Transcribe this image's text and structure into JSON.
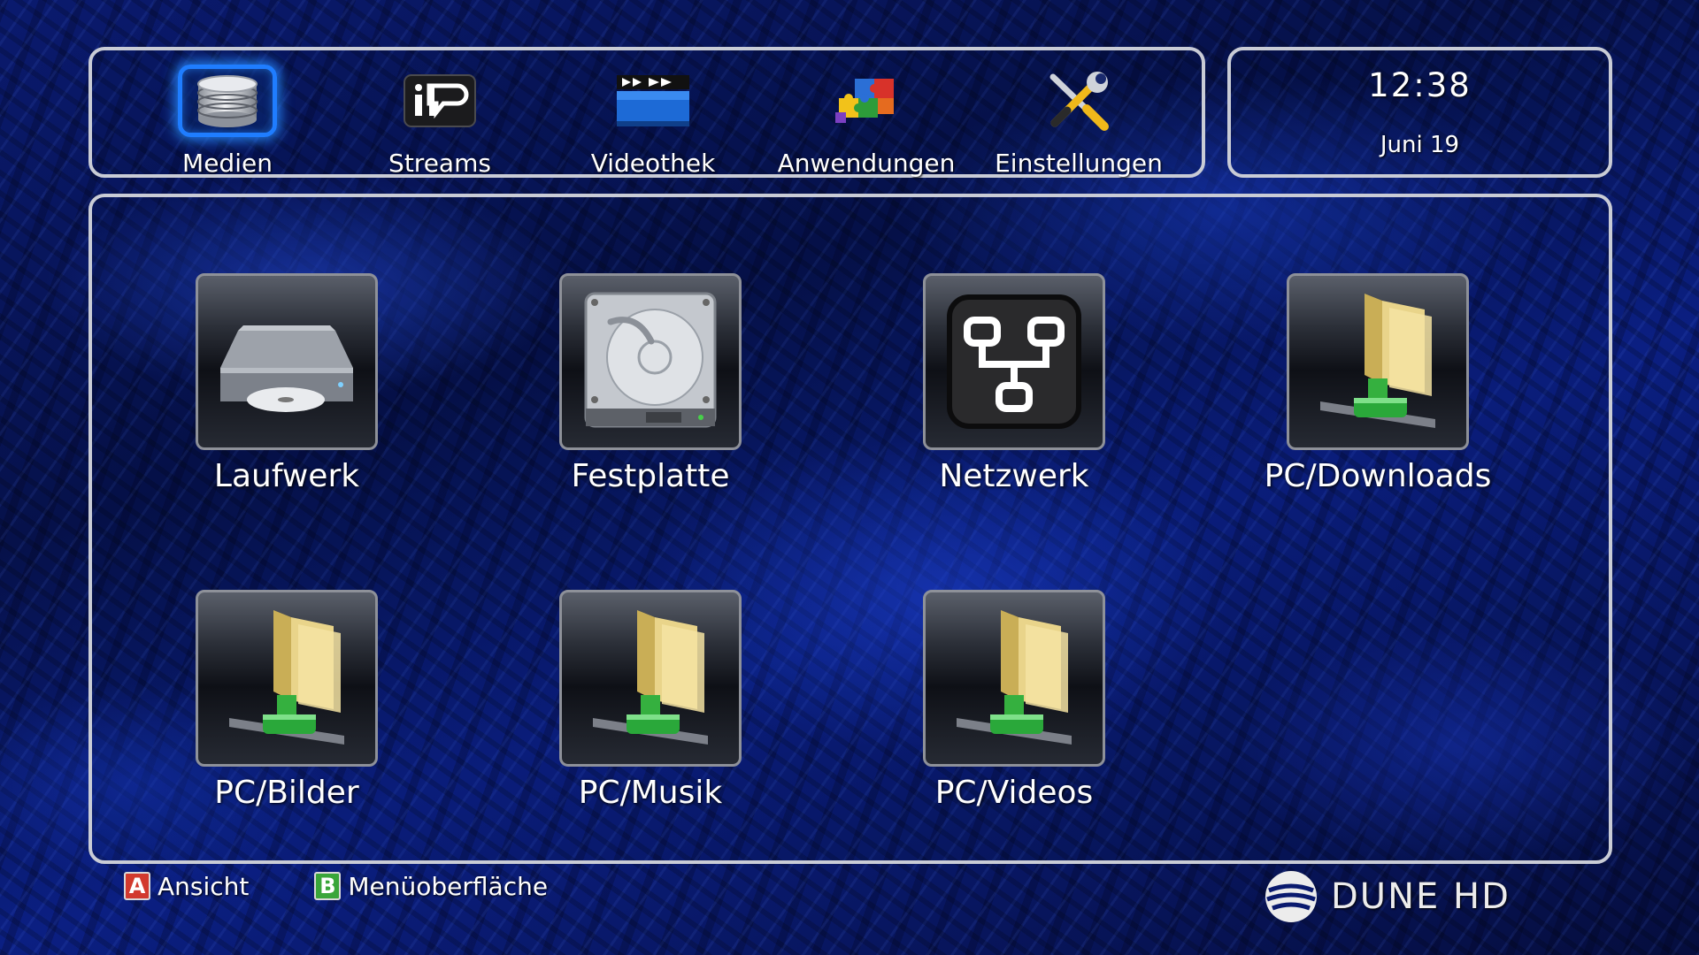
{
  "nav": {
    "items": [
      {
        "label": "Medien",
        "icon": "database-icon",
        "selected": true
      },
      {
        "label": "Streams",
        "icon": "iptv-icon",
        "selected": false
      },
      {
        "label": "Videothek",
        "icon": "clapperboard-icon",
        "selected": false
      },
      {
        "label": "Anwendungen",
        "icon": "puzzle-icon",
        "selected": false
      },
      {
        "label": "Einstellungen",
        "icon": "tools-icon",
        "selected": false
      }
    ],
    "accent": "#1f7dff"
  },
  "clock": {
    "time": "12:38",
    "date": "Juni 19"
  },
  "sources": [
    {
      "label": "Laufwerk",
      "icon": "optical-drive-icon"
    },
    {
      "label": "Festplatte",
      "icon": "hard-disk-icon"
    },
    {
      "label": "Netzwerk",
      "icon": "network-icon"
    },
    {
      "label": "PC/Downloads",
      "icon": "network-folder-icon"
    },
    {
      "label": "PC/Bilder",
      "icon": "network-folder-icon"
    },
    {
      "label": "PC/Musik",
      "icon": "network-folder-icon"
    },
    {
      "label": "PC/Videos",
      "icon": "network-folder-icon"
    }
  ],
  "hints": [
    {
      "key": "A",
      "label": "Ansicht",
      "color": "#d23a2e"
    },
    {
      "key": "B",
      "label": "Menüoberfläche",
      "color": "#3aa63a"
    }
  ],
  "brand": {
    "text": "DUNE HD"
  }
}
